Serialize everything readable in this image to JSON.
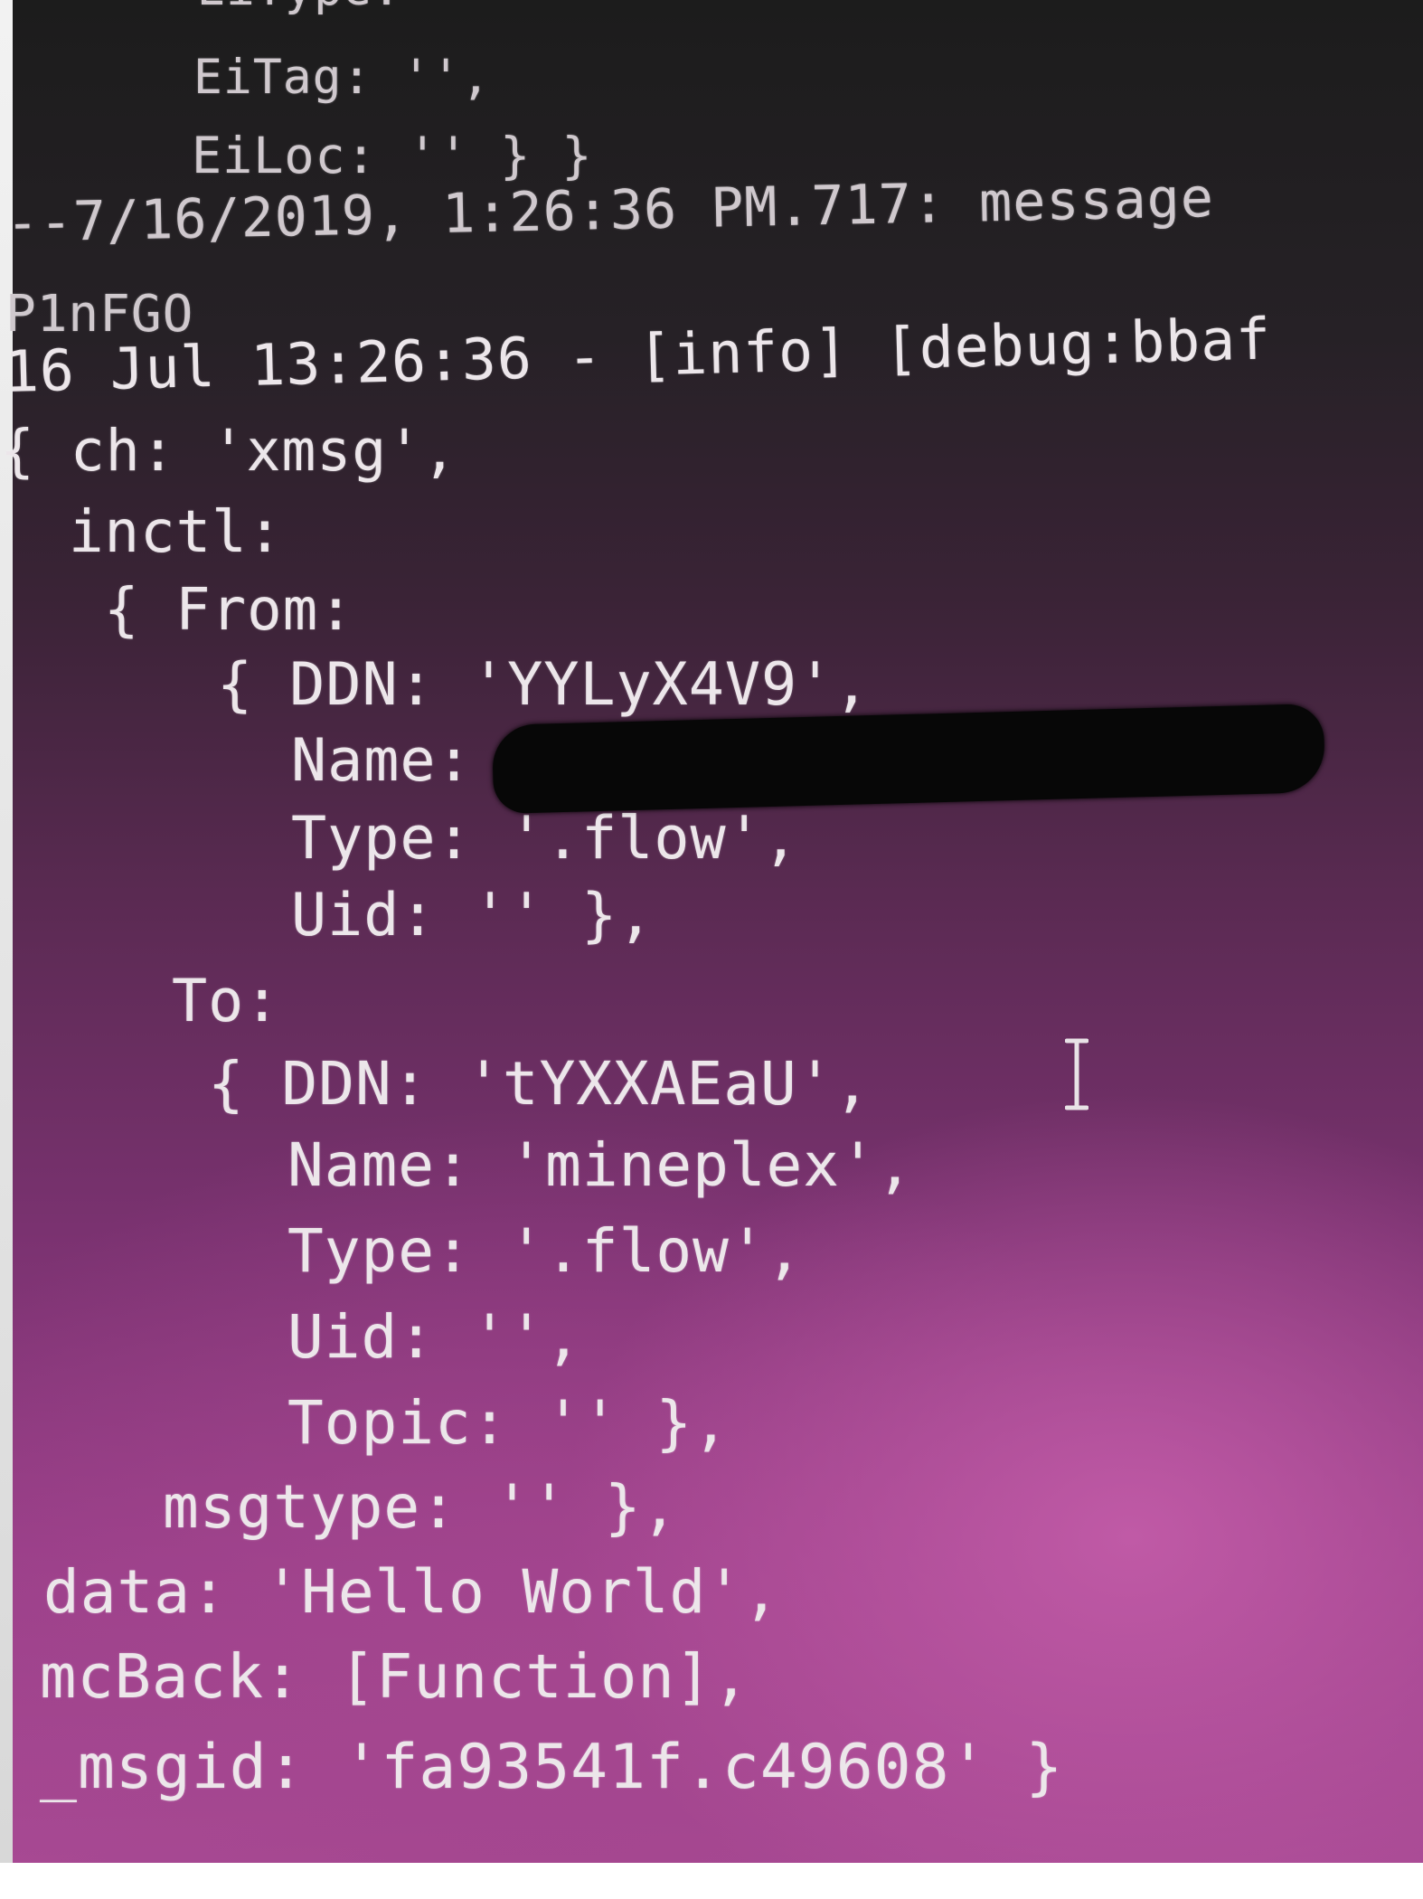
{
  "terminal": {
    "lines": [
      "EiType: ''",
      "EiTag: '',",
      "EiLoc: '' } }",
      "--7/16/2019, 1:26:36 PM.717: message",
      "P1nFGO",
      "16 Jul 13:26:36 - [info] [debug:bbaf",
      "{ ch: 'xmsg',",
      "inctl:",
      "{ From:",
      "{ DDN: 'YYLyX4V9',",
      "Name:",
      "Type: '.flow',",
      "Uid: '' },",
      "To:",
      "{ DDN: 'tYXXAEaU',",
      "Name: 'mineplex',",
      "Type: '.flow',",
      "Uid: '',",
      "Topic: '' },",
      "msgtype: '' },",
      "data: 'Hello World',",
      "mcBack: [Function],",
      "_msgid: 'fa93541f.c49608' }"
    ]
  },
  "cursor": {
    "icon": "text-cursor-icon"
  },
  "redaction": {
    "color": "#070707"
  },
  "colors": {
    "text": "#ece6ea",
    "background_top": "#1c1c1c",
    "background_bottom": "#a84a94"
  }
}
